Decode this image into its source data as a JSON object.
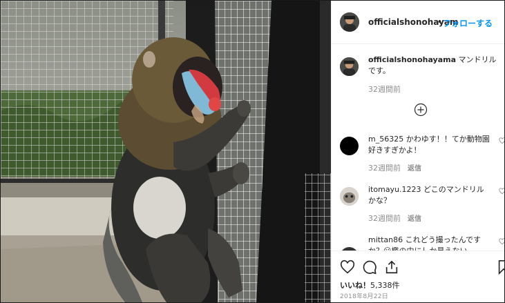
{
  "header": {
    "username": "officialshonohayam",
    "dot": "•",
    "follow_label": "フォローする"
  },
  "caption": {
    "username": "officialshonohayama",
    "text": " マンドリル です。",
    "time": "32週間前"
  },
  "comments": [
    {
      "username": "m_56325",
      "text": " かわゆす！！てか動物園好きすぎかよ！",
      "time": "32週間前",
      "reply": "返信"
    },
    {
      "username": "itomayu.1223",
      "text": " どこのマンドリルかな？",
      "time": "32週間前",
      "reply": "返信"
    },
    {
      "username": "mittan86",
      "text": " これどう撮ったんですか？😮檻の中にしか見えない",
      "time": "",
      "reply": ""
    }
  ],
  "actions": {
    "likes_label": "いいね！",
    "likes_count": "5,338件",
    "date": "2018年8月22日"
  },
  "icons": [
    "more-options-icon",
    "load-more-comments-icon",
    "heart-icon",
    "comment-icon",
    "share-icon",
    "bookmark-icon"
  ],
  "colors": {
    "link": "#0095f6",
    "text": "#262626",
    "muted": "#8e8e8e",
    "border": "#efefef"
  }
}
